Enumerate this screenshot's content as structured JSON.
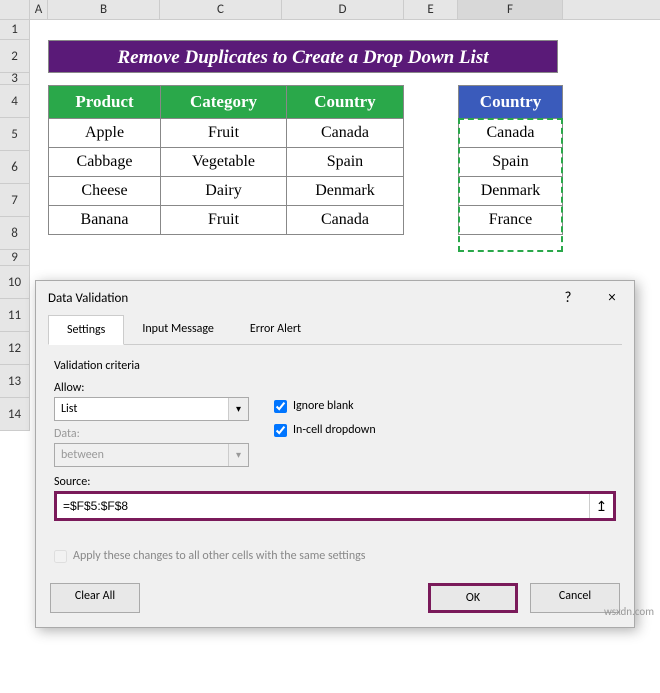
{
  "columns": [
    "A",
    "B",
    "C",
    "D",
    "E",
    "F"
  ],
  "rows": [
    "1",
    "2",
    "3",
    "4",
    "5",
    "6",
    "7",
    "8",
    "9",
    "10",
    "11",
    "12",
    "13",
    "14"
  ],
  "title": "Remove Duplicates to Create a Drop Down List",
  "main_headers": [
    "Product",
    "Category",
    "Country"
  ],
  "main_data": [
    [
      "Apple",
      "Fruit",
      "Canada"
    ],
    [
      "Cabbage",
      "Vegetable",
      "Spain"
    ],
    [
      "Cheese",
      "Dairy",
      "Denmark"
    ],
    [
      "Banana",
      "Fruit",
      "Canada"
    ]
  ],
  "list_header": "Country",
  "list_data": [
    "Canada",
    "Spain",
    "Denmark",
    "France"
  ],
  "dialog": {
    "title": "Data Validation",
    "help": "?",
    "close": "×",
    "tabs": [
      "Settings",
      "Input Message",
      "Error Alert"
    ],
    "criteria": "Validation criteria",
    "allow_label": "Allow:",
    "allow_value": "List",
    "data_label": "Data:",
    "data_value": "between",
    "ignore_blank": "Ignore blank",
    "incell": "In-cell dropdown",
    "source_label": "Source:",
    "source_value": "=$F$5:$F$8",
    "apply_changes": "Apply these changes to all other cells with the same settings",
    "clear_all": "Clear All",
    "ok": "OK",
    "cancel": "Cancel"
  },
  "watermark": "wsxdn.com"
}
